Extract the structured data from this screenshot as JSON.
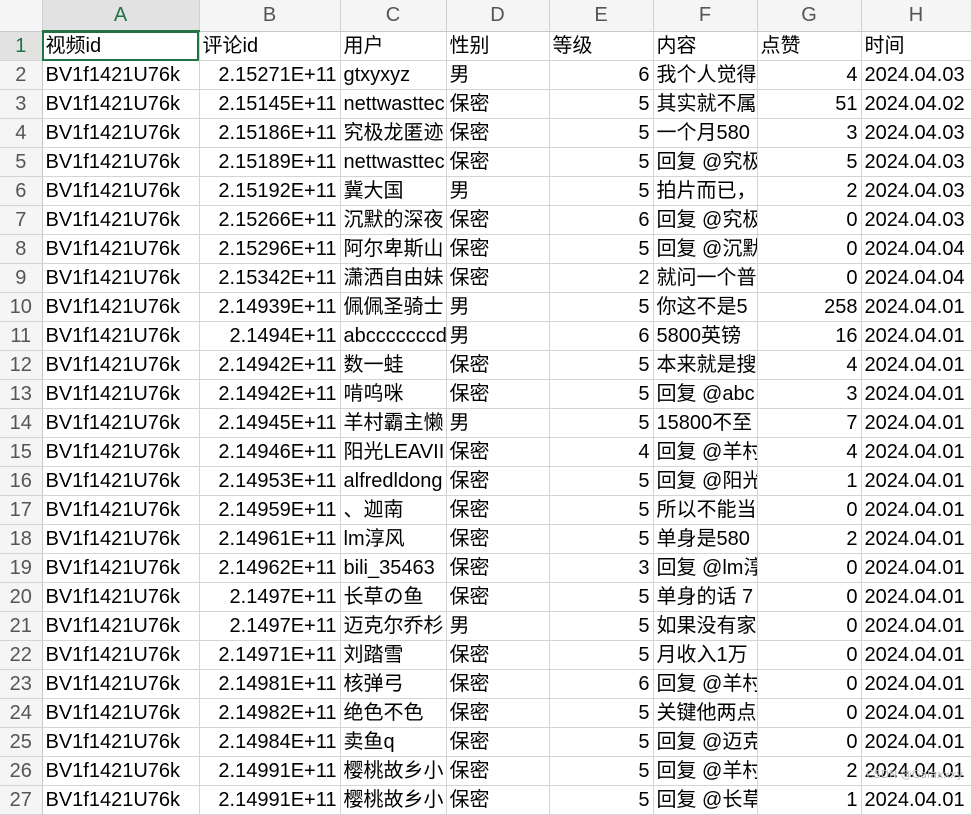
{
  "columns": [
    "A",
    "B",
    "C",
    "D",
    "E",
    "F",
    "G",
    "H"
  ],
  "header_row": {
    "row_number": "1",
    "cells": [
      "视频id",
      "评论id",
      "用户",
      "性别",
      "等级",
      "内容",
      "点赞",
      "时间"
    ]
  },
  "rows": [
    {
      "n": "2",
      "cells": [
        "BV1f1421U76k",
        "2.15271E+11",
        "gtxyxyz",
        "男",
        "6",
        "我个人觉得",
        "4",
        "2024.04.03"
      ]
    },
    {
      "n": "3",
      "cells": [
        "BV1f1421U76k",
        "2.15145E+11",
        "nettwasttec",
        "保密",
        "5",
        "其实就不属",
        "51",
        "2024.04.02"
      ]
    },
    {
      "n": "4",
      "cells": [
        "BV1f1421U76k",
        "2.15186E+11",
        "究极龙匿迹",
        "保密",
        "5",
        "一个月580",
        "3",
        "2024.04.03"
      ]
    },
    {
      "n": "5",
      "cells": [
        "BV1f1421U76k",
        "2.15189E+11",
        "nettwasttec",
        "保密",
        "5",
        "回复 @究极",
        "5",
        "2024.04.03"
      ]
    },
    {
      "n": "6",
      "cells": [
        "BV1f1421U76k",
        "2.15192E+11",
        "冀大国",
        "男",
        "5",
        "拍片而已，",
        "2",
        "2024.04.03"
      ]
    },
    {
      "n": "7",
      "cells": [
        "BV1f1421U76k",
        "2.15266E+11",
        "沉默的深夜",
        "保密",
        "6",
        "回复 @究极",
        "0",
        "2024.04.03"
      ]
    },
    {
      "n": "8",
      "cells": [
        "BV1f1421U76k",
        "2.15296E+11",
        "阿尔卑斯山",
        "保密",
        "5",
        "回复 @沉默",
        "0",
        "2024.04.04"
      ]
    },
    {
      "n": "9",
      "cells": [
        "BV1f1421U76k",
        "2.15342E+11",
        "潇洒自由妹",
        "保密",
        "2",
        "就问一个普",
        "0",
        "2024.04.04"
      ]
    },
    {
      "n": "10",
      "cells": [
        "BV1f1421U76k",
        "2.14939E+11",
        "佩佩圣骑士",
        "男",
        "5",
        "你这不是5",
        "258",
        "2024.04.01"
      ]
    },
    {
      "n": "11",
      "cells": [
        "BV1f1421U76k",
        "2.1494E+11",
        "abcccccccd",
        "男",
        "6",
        "5800英镑",
        "16",
        "2024.04.01"
      ]
    },
    {
      "n": "12",
      "cells": [
        "BV1f1421U76k",
        "2.14942E+11",
        "数一蛙",
        "保密",
        "5",
        "本来就是搜",
        "4",
        "2024.04.01"
      ]
    },
    {
      "n": "13",
      "cells": [
        "BV1f1421U76k",
        "2.14942E+11",
        "啃呜咪",
        "保密",
        "5",
        "回复 @abc",
        "3",
        "2024.04.01"
      ]
    },
    {
      "n": "14",
      "cells": [
        "BV1f1421U76k",
        "2.14945E+11",
        "羊村霸主懒",
        "男",
        "5",
        "15800不至",
        "7",
        "2024.04.01"
      ]
    },
    {
      "n": "15",
      "cells": [
        "BV1f1421U76k",
        "2.14946E+11",
        "阳光LEAVII",
        "保密",
        "4",
        "回复 @羊村",
        "4",
        "2024.04.01"
      ]
    },
    {
      "n": "16",
      "cells": [
        "BV1f1421U76k",
        "2.14953E+11",
        "alfredldong",
        "保密",
        "5",
        "回复 @阳光",
        "1",
        "2024.04.01"
      ]
    },
    {
      "n": "17",
      "cells": [
        "BV1f1421U76k",
        "2.14959E+11",
        "、迦南",
        "保密",
        "5",
        "所以不能当",
        "0",
        "2024.04.01"
      ]
    },
    {
      "n": "18",
      "cells": [
        "BV1f1421U76k",
        "2.14961E+11",
        "lm淳风",
        "保密",
        "5",
        "单身是580",
        "2",
        "2024.04.01"
      ]
    },
    {
      "n": "19",
      "cells": [
        "BV1f1421U76k",
        "2.14962E+11",
        "bili_35463",
        "保密",
        "3",
        "回复 @lm淳",
        "0",
        "2024.04.01"
      ]
    },
    {
      "n": "20",
      "cells": [
        "BV1f1421U76k",
        "2.1497E+11",
        "长草の鱼",
        "保密",
        "5",
        "单身的话 7",
        "0",
        "2024.04.01"
      ]
    },
    {
      "n": "21",
      "cells": [
        "BV1f1421U76k",
        "2.1497E+11",
        "迈克尔乔杉",
        "男",
        "5",
        "如果没有家",
        "0",
        "2024.04.01"
      ]
    },
    {
      "n": "22",
      "cells": [
        "BV1f1421U76k",
        "2.14971E+11",
        "刘踏雪",
        "保密",
        "5",
        "月收入1万",
        "0",
        "2024.04.01"
      ]
    },
    {
      "n": "23",
      "cells": [
        "BV1f1421U76k",
        "2.14981E+11",
        "核弹弓",
        "保密",
        "6",
        "回复 @羊村",
        "0",
        "2024.04.01"
      ]
    },
    {
      "n": "24",
      "cells": [
        "BV1f1421U76k",
        "2.14982E+11",
        "绝色不色",
        "保密",
        "5",
        "关键他两点",
        "0",
        "2024.04.01"
      ]
    },
    {
      "n": "25",
      "cells": [
        "BV1f1421U76k",
        "2.14984E+11",
        "卖鱼q",
        "保密",
        "5",
        "回复 @迈克",
        "0",
        "2024.04.01"
      ]
    },
    {
      "n": "26",
      "cells": [
        "BV1f1421U76k",
        "2.14991E+11",
        "樱桃故乡小",
        "保密",
        "5",
        "回复 @羊村",
        "2",
        "2024.04.01"
      ]
    },
    {
      "n": "27",
      "cells": [
        "BV1f1421U76k",
        "2.14991E+11",
        "樱桃故乡小",
        "保密",
        "5",
        "回复 @长草",
        "1",
        "2024.04.01"
      ]
    }
  ],
  "watermark": "CSDN @Galaxxxy",
  "colors": {
    "selection": "#217346",
    "grid": "#d4d4d4",
    "header_bg": "#f5f5f5"
  }
}
